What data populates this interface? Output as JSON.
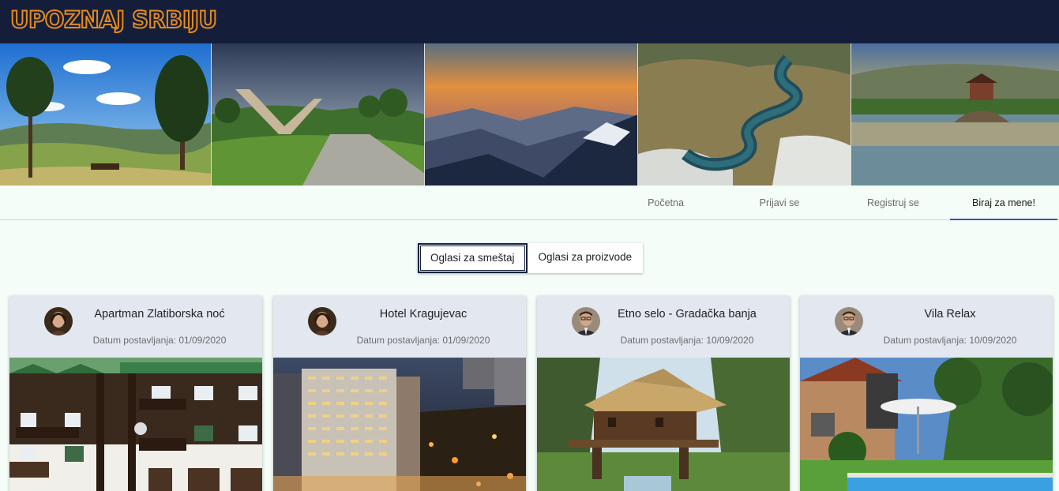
{
  "brand": {
    "logo_text": "UPOZNAJ SRBIJU",
    "accent": "#e58a1f",
    "topbar_color": "#141e3a"
  },
  "banner": {
    "images": [
      {
        "name": "banner-zlatibor-meadow"
      },
      {
        "name": "banner-monument-field"
      },
      {
        "name": "banner-misty-mountains"
      },
      {
        "name": "banner-meandering-river"
      },
      {
        "name": "banner-drina-river-house"
      }
    ]
  },
  "nav": {
    "tabs": [
      {
        "label": "Početna",
        "active": false
      },
      {
        "label": "Prijavi se",
        "active": false
      },
      {
        "label": "Registruj se",
        "active": false
      },
      {
        "label": "Biraj za mene!",
        "active": true
      }
    ],
    "active_color": "#3f51b5"
  },
  "toggle": {
    "options": [
      {
        "label": "Oglasi za smeštaj",
        "selected": true
      },
      {
        "label": "Oglasi za proizvode",
        "selected": false
      }
    ]
  },
  "listings": [
    {
      "title": "Apartman Zlatiborska noć",
      "date": "Datum postavljanja: 01/09/2020",
      "avatar": "woman-avatar",
      "photo": "apartment-building-photo"
    },
    {
      "title": "Hotel Kragujevac",
      "date": "Datum postavljanja: 01/09/2020",
      "avatar": "woman-avatar",
      "photo": "hotel-night-photo"
    },
    {
      "title": "Etno selo - Gradačka banja",
      "date": "Datum postavljanja: 10/09/2020",
      "avatar": "man-avatar",
      "photo": "ethno-village-photo"
    },
    {
      "title": "Vila Relax",
      "date": "Datum postavljanja: 10/09/2020",
      "avatar": "man-avatar",
      "photo": "villa-pool-photo"
    }
  ]
}
